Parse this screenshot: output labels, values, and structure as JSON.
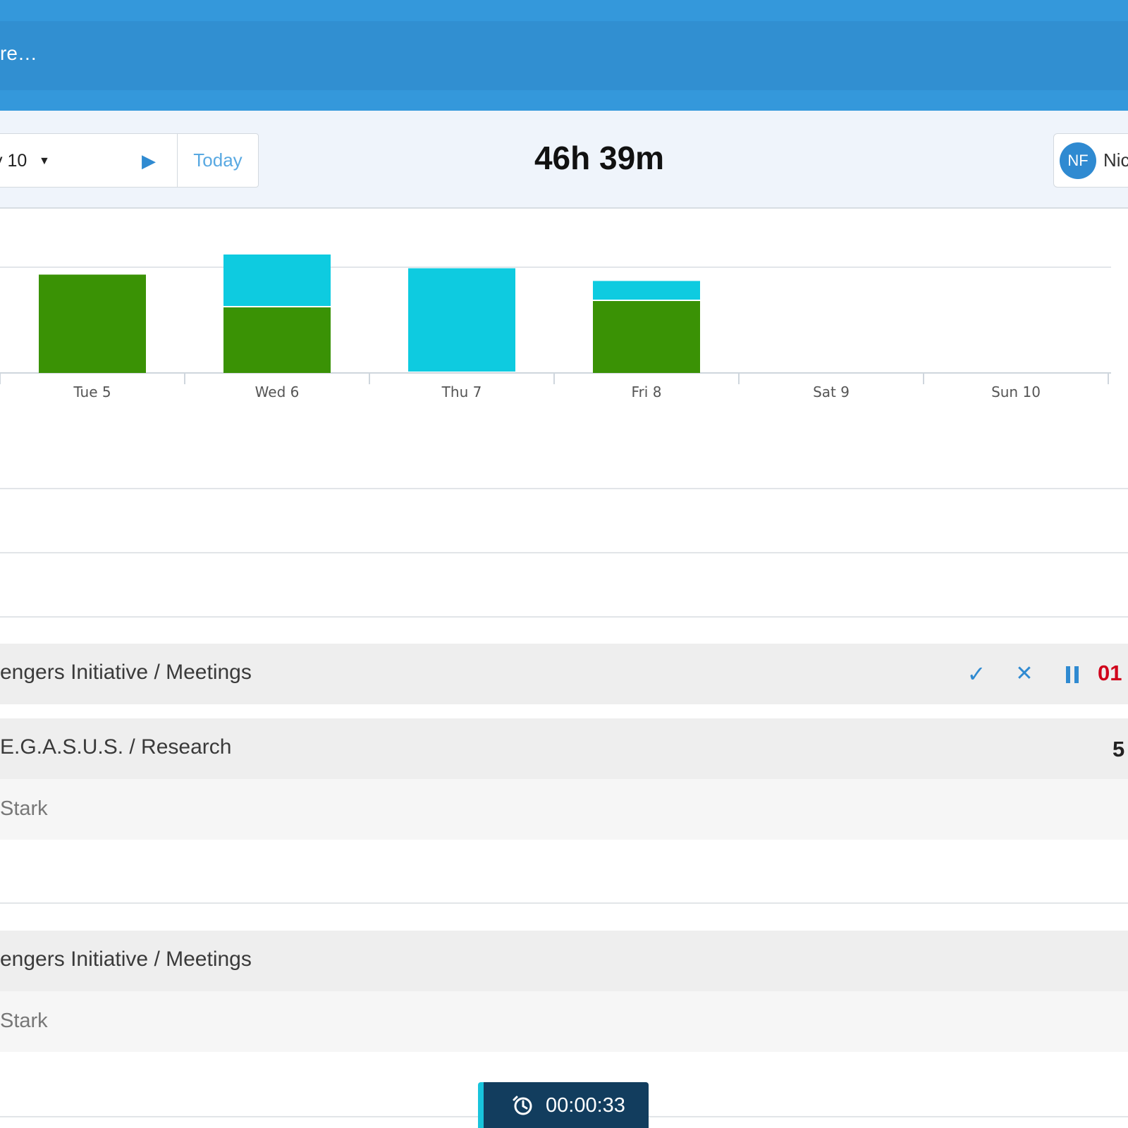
{
  "header": {
    "search_text": "re…"
  },
  "toolbar": {
    "week_label": "y 10",
    "today_label": "Today",
    "total_hours": "46h 39m",
    "user_initials": "NF",
    "user_name": "Nic"
  },
  "chart_data": {
    "type": "bar",
    "stacked": true,
    "categories": [
      "Tue 5",
      "Wed 6",
      "Thu 7",
      "Fri 8",
      "Sat 9",
      "Sun 10"
    ],
    "series": [
      {
        "name": "",
        "color": "#3a9205",
        "values": [
          9.3,
          6.2,
          0,
          6.8,
          0,
          0
        ]
      },
      {
        "name": "",
        "color": "#0ecbe0",
        "values": [
          0,
          5.0,
          9.9,
          1.9,
          0,
          0
        ]
      }
    ],
    "ylim": [
      0,
      12
    ],
    "gridline": 10,
    "grid": true
  },
  "entries": [
    {
      "title": "engers Initiative / Meetings",
      "running_time": "01",
      "running": true
    },
    {
      "title": "E.G.A.S.U.S. / Research",
      "client": "Stark",
      "duration": "5"
    },
    {
      "title": "engers Initiative / Meetings",
      "client": "Stark"
    }
  ],
  "timer": {
    "value": "00:00:33"
  },
  "icons": {
    "play": "play-icon",
    "caret": "caret-down-icon",
    "check": "check-icon",
    "close": "close-icon",
    "pause": "pause-icon",
    "timer": "stopwatch-icon"
  }
}
